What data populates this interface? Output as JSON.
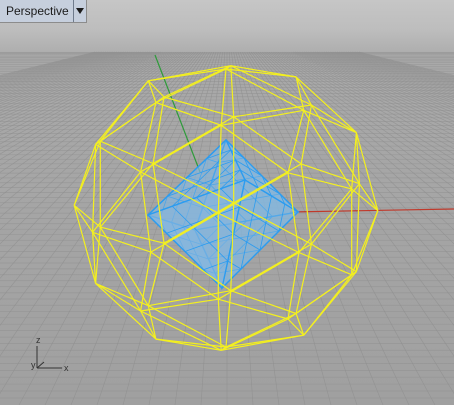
{
  "viewport": {
    "title": "Perspective",
    "dropdown_icon": "triangle-down-icon"
  },
  "axis_gizmo": {
    "z_label": "z",
    "y_label": "y",
    "x_label": "x"
  },
  "colors": {
    "sphere_wireframe": "#f4f01e",
    "octahedron_wireframe": "#2b9cf0",
    "octahedron_fill": "#86b7de",
    "x_axis": "#c0392b",
    "y_axis": "#2e9b3a",
    "grid_line": "#8f8f8f"
  }
}
